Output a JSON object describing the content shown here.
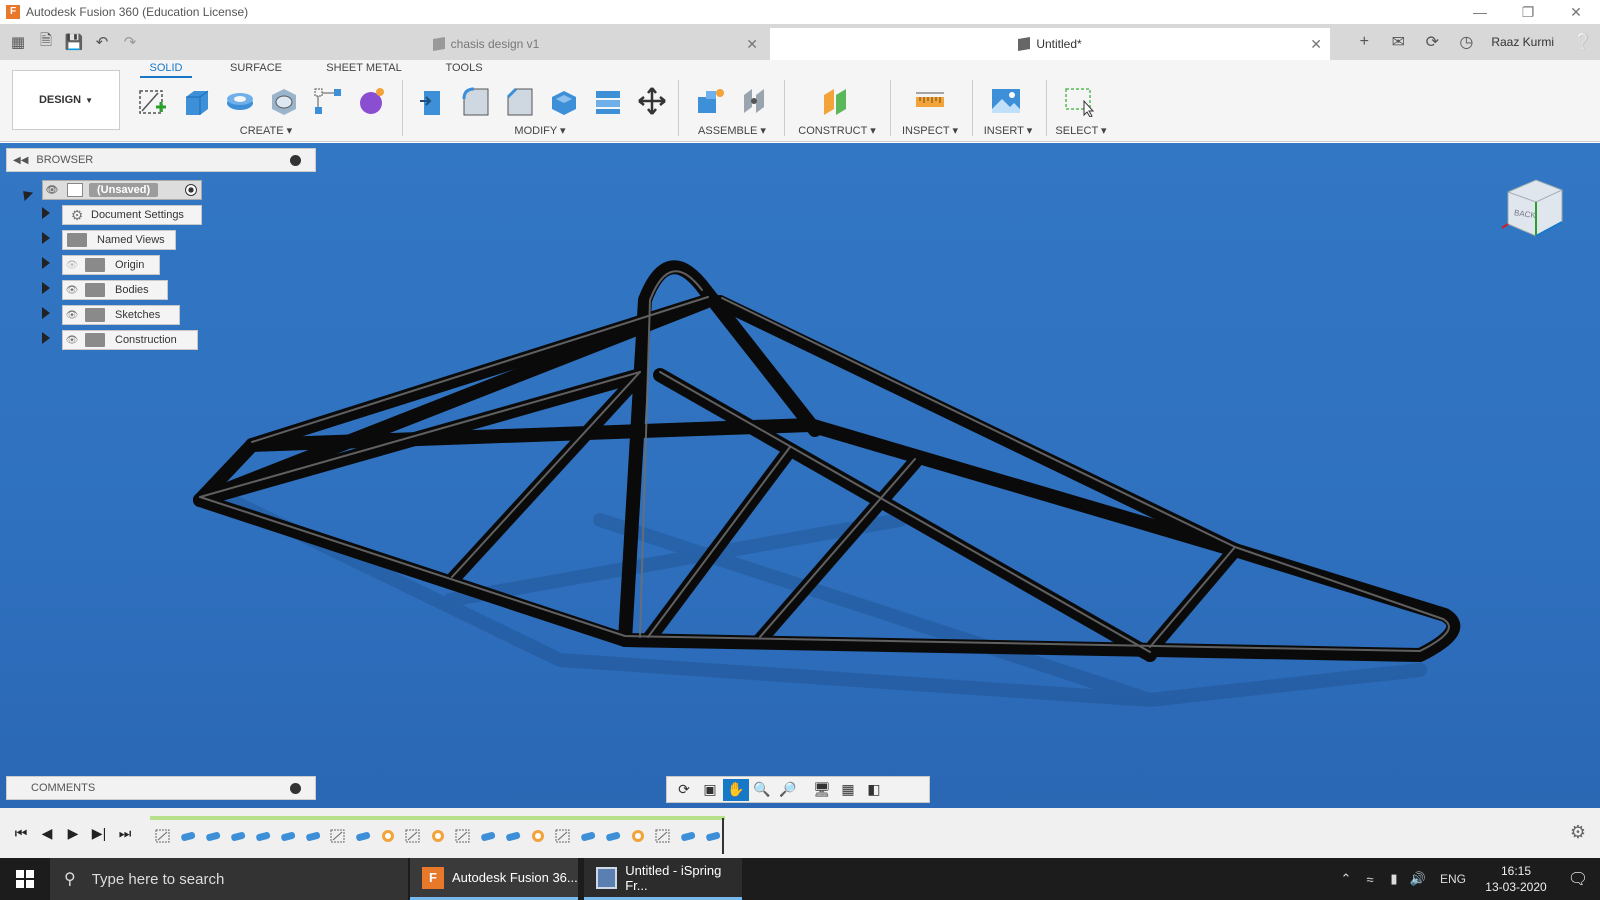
{
  "window": {
    "title": "Autodesk Fusion 360 (Education License)",
    "controls": [
      "minimize-icon",
      "restore-icon",
      "close-icon"
    ]
  },
  "tabs": [
    {
      "label": "chasis design v1",
      "active": false
    },
    {
      "label": "Untitled*",
      "active": true
    }
  ],
  "header": {
    "user": "Raaz Kurmi"
  },
  "toolbar": {
    "workspace": "DESIGN",
    "workspace_tabs": [
      "SOLID",
      "SURFACE",
      "SHEET METAL",
      "TOOLS"
    ],
    "groups": {
      "create": "CREATE",
      "modify": "MODIFY",
      "assemble": "ASSEMBLE",
      "construct": "CONSTRUCT",
      "inspect": "INSPECT",
      "insert": "INSERT",
      "select": "SELECT"
    }
  },
  "browser": {
    "title": "BROWSER",
    "root": "(Unsaved)",
    "items": [
      {
        "label": "Document Settings",
        "icon": "gear-icon"
      },
      {
        "label": "Named Views",
        "icon": "folder-icon"
      },
      {
        "label": "Origin",
        "icon": "folder-icon"
      },
      {
        "label": "Bodies",
        "icon": "folder-icon"
      },
      {
        "label": "Sketches",
        "icon": "folder-icon"
      },
      {
        "label": "Construction",
        "icon": "folder-icon"
      }
    ]
  },
  "viewcube": {
    "face": "BACK"
  },
  "comments": {
    "title": "COMMENTS"
  },
  "taskbar": {
    "search_placeholder": "Type here to search",
    "apps": [
      {
        "label": "Autodesk Fusion 36..."
      },
      {
        "label": "Untitled - iSpring Fr..."
      }
    ],
    "language": "ENG",
    "time": "16:15",
    "date": "13-03-2020"
  },
  "colors": {
    "accent": "#1878c8",
    "viewport": "#3174c2",
    "timeline_progress": "#b8e08a"
  }
}
